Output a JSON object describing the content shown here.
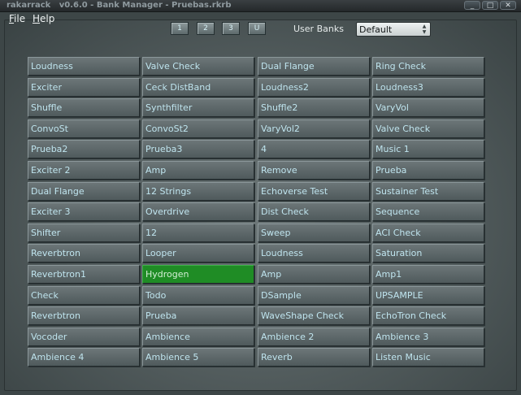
{
  "window": {
    "title": "rakarrack   v0.6.0 - Bank Manager - Pruebas.rkrb",
    "controls": [
      "_",
      "□",
      "✕"
    ]
  },
  "menu": [
    {
      "mnemonic": "F",
      "rest": "ile"
    },
    {
      "mnemonic": "H",
      "rest": "elp"
    }
  ],
  "bank_buttons": [
    "1",
    "2",
    "3",
    "U"
  ],
  "user_banks": {
    "label": "User Banks",
    "selected": "Default"
  },
  "selected_preset": "Hydrogen",
  "presets": [
    "Loudness",
    "Valve Check",
    "Dual Flange",
    "Ring Check",
    "Exciter",
    "Ceck DistBand",
    "Loudness2",
    "Loudness3",
    "Shuffle",
    "Synthfilter",
    "Shuffle2",
    "VaryVol",
    "ConvoSt",
    "ConvoSt2",
    "VaryVol2",
    "Valve Check",
    "Prueba2",
    "Prueba3",
    "4",
    "Music 1",
    "Exciter 2",
    "Amp",
    "Remove",
    "Prueba",
    "Dual Flange",
    "12 Strings",
    "Echoverse Test",
    "Sustainer Test",
    "Exciter 3",
    "Overdrive",
    "Dist Check",
    "Sequence",
    "Shifter",
    "12",
    "Sweep",
    "ACI Check",
    "Reverbtron",
    "Looper",
    "Loudness",
    "Saturation",
    "Reverbtron1",
    "Hydrogen",
    "Amp",
    "Amp1",
    "Check",
    "Todo",
    "DSample",
    "UPSAMPLE",
    "Reverbtron",
    "Prueba",
    "WaveShape Check",
    "EchoTron Check",
    "Vocoder",
    "Ambience",
    "Ambience 2",
    "Ambience 3",
    "Ambience 4",
    "Ambience 5",
    "Reverb",
    "Listen Music"
  ]
}
